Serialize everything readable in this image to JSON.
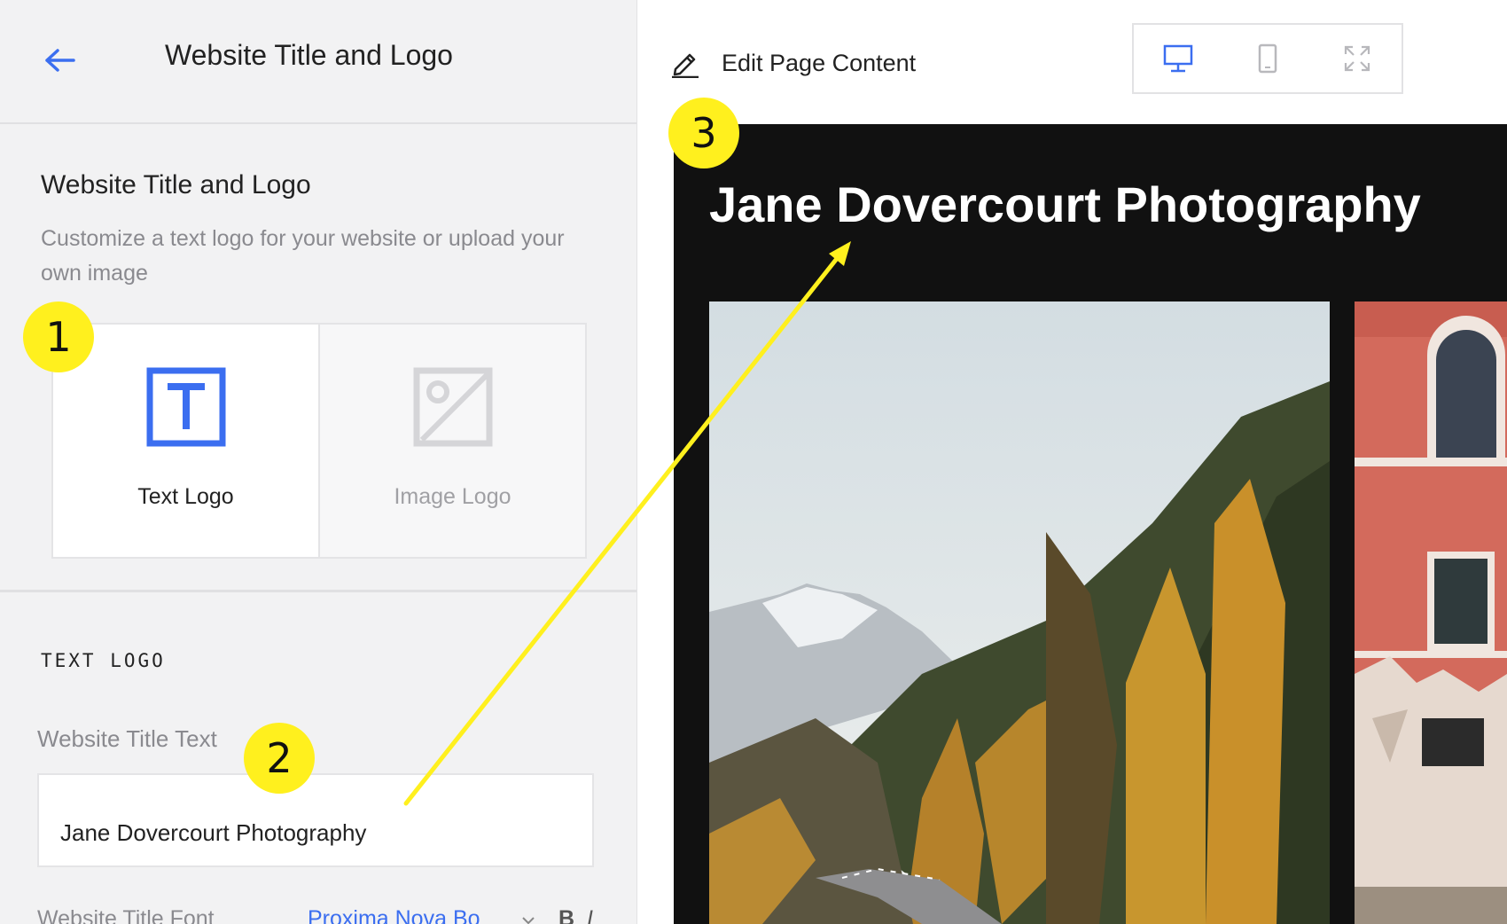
{
  "header": {
    "title": "Website Title and Logo"
  },
  "section": {
    "title": "Website Title and Logo",
    "description": "Customize a text logo for your website or upload your own image"
  },
  "logo_options": [
    {
      "label": "Text Logo",
      "icon": "text-logo-icon",
      "selected": true
    },
    {
      "label": "Image Logo",
      "icon": "image-logo-icon",
      "selected": false
    }
  ],
  "text_logo": {
    "heading": "TEXT LOGO",
    "title_field_label": "Website Title Text",
    "title_value": "Jane Dovercourt Photography",
    "font_label": "Website Title Font",
    "font_value": "Proxima Nova Bo",
    "bold": "B",
    "italic": "I"
  },
  "toolbar": {
    "edit_label": "Edit Page Content"
  },
  "devices": [
    "desktop-icon",
    "mobile-icon",
    "fullscreen-icon"
  ],
  "preview": {
    "site_title": "Jane Dovercourt Photography"
  },
  "annotations": [
    "1",
    "2",
    "3"
  ],
  "colors": {
    "accent": "#3b6ef0",
    "annotation": "#fff01e",
    "preview_bg": "#111111",
    "panel_bg": "#f2f2f3"
  }
}
